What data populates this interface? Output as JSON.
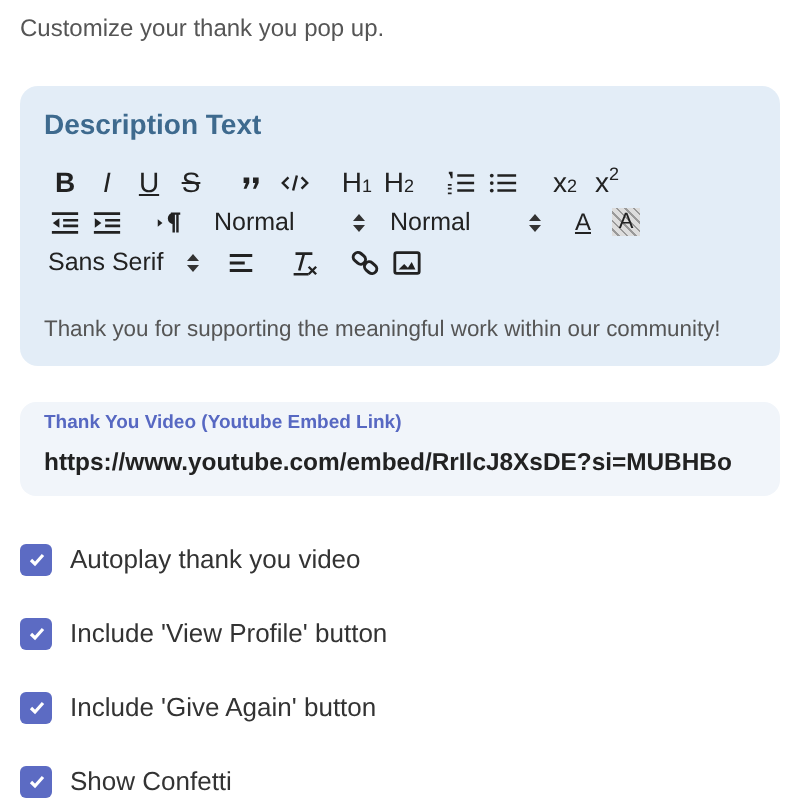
{
  "intro": "Customize your thank you pop up.",
  "description_editor": {
    "title": "Description Text",
    "toolbar_rows": [
      [
        [
          {
            "kind": "bold",
            "text": "B"
          },
          {
            "kind": "italic",
            "text": "I"
          },
          {
            "kind": "underline",
            "text": "U"
          },
          {
            "kind": "strike",
            "text": "S"
          }
        ],
        [
          {
            "kind": "quote"
          },
          {
            "kind": "code"
          }
        ],
        [
          {
            "kind": "glyph",
            "text": "H$_{1}$"
          },
          {
            "kind": "glyph",
            "text": "H$_{2}$"
          }
        ],
        [
          {
            "kind": "ordered"
          },
          {
            "kind": "bullet"
          }
        ],
        [
          {
            "kind": "glyph",
            "text": "x$_{2}$"
          },
          {
            "kind": "glyph",
            "text": "x$^{2}$"
          }
        ]
      ],
      [
        [
          {
            "kind": "outdent"
          },
          {
            "kind": "indent"
          }
        ],
        [
          {
            "kind": "direction"
          }
        ],
        [
          {
            "kind": "select",
            "text": "Normal"
          }
        ],
        [
          {
            "kind": "select",
            "text": "Normal"
          }
        ],
        [
          {
            "kind": "color",
            "text": "A"
          },
          {
            "kind": "background",
            "text": "A"
          }
        ]
      ],
      [
        [
          {
            "kind": "select",
            "text": "Sans Serif"
          }
        ],
        [
          {
            "kind": "align"
          }
        ],
        [
          {
            "kind": "clean"
          }
        ],
        [
          {
            "kind": "link"
          },
          {
            "kind": "image"
          }
        ]
      ]
    ],
    "content": "Thank you for supporting the meaningful work within our community!"
  },
  "video_field": {
    "label": "Thank You Video (Youtube Embed Link)",
    "value": "https://www.youtube.com/embed/RrIlcJ8XsDE?si=MUBHBo"
  },
  "options": [
    {
      "label": "Autoplay thank you video",
      "checked": true
    },
    {
      "label": "Include 'View Profile' button",
      "checked": true
    },
    {
      "label": "Include 'Give Again' button",
      "checked": true
    },
    {
      "label": "Show Confetti",
      "checked": true
    }
  ]
}
